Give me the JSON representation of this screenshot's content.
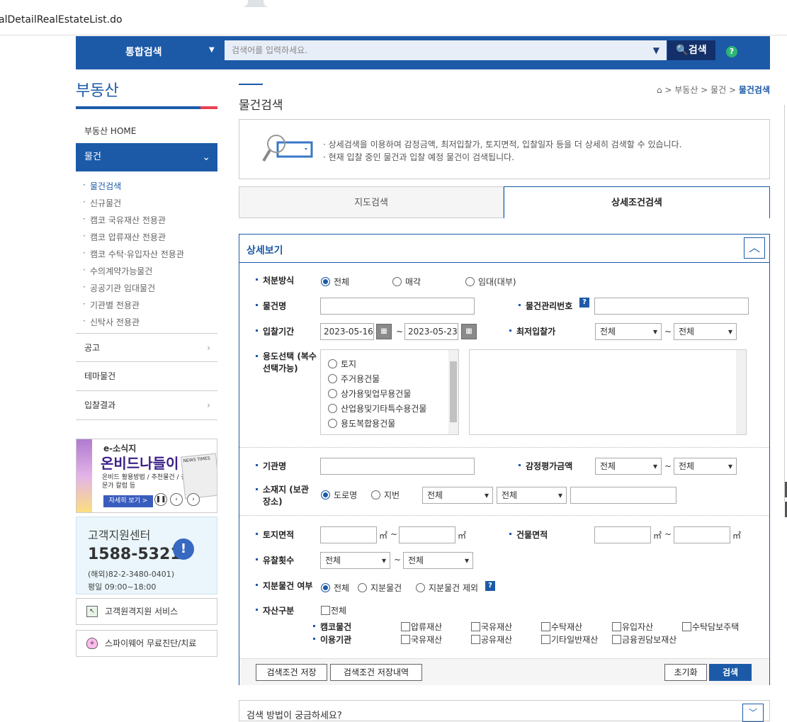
{
  "browser": {
    "url": "alDetailRealEstateList.do"
  },
  "top": {
    "scope": "통합검색",
    "placeholder": "검색어를 입력하세요.",
    "search_btn": "검색",
    "help": "?"
  },
  "lnb": {
    "title": "부동산",
    "home": "부동산 HOME",
    "current": "물건",
    "sub": [
      "물건검색",
      "신규물건",
      "캠코 국유재산 전용관",
      "캠코 압류재산 전용관",
      "캠코 수탁·유입자산 전용관",
      "수의계약가능물건",
      "공공기관 임대물건",
      "기관별 전용관",
      "신탁사 전용관"
    ],
    "menus": [
      "공고",
      "테마물건",
      "입찰결과"
    ]
  },
  "banner": {
    "t1": "e-소식지",
    "t2": "온비드나들이",
    "t3": "온비드 활용방법 / 추천물건 / 전문가 칼럼 등",
    "more": "자세히 보기 >",
    "paper": "NEWS TIMES"
  },
  "support": {
    "title": "고객지원센터",
    "phone": "1588-5321",
    "overseas": "(해외)82-2-3480-0401)",
    "hours": "평일 09:00~18:00"
  },
  "remote": "고객원격지원 서비스",
  "spyware": "스파이웨어 무료진단/치료",
  "page": {
    "title": "물건검색",
    "crumb": [
      "부동산",
      "물건",
      "물건검색"
    ],
    "info": [
      "· 상세검색을 이용하여 감정금액, 최저입찰가, 토지면적, 입찰일자 등을 더 상세히 검색할 수 있습니다.",
      "· 현재 입찰 중인 물건과 입찰 예정 물건이 검색됩니다."
    ],
    "tabs": [
      "지도검색",
      "상세조건검색"
    ]
  },
  "form": {
    "header": "상세보기",
    "disposal": {
      "label": "처분방식",
      "opts": [
        "전체",
        "매각",
        "임대(대부)"
      ]
    },
    "name_label": "물건명",
    "mgmt_label": "물건관리번호",
    "period": {
      "label": "입찰기간",
      "from": "2023-05-16",
      "to": "2023-05-23"
    },
    "minbid": {
      "label": "최저입찰가",
      "a": "전체",
      "b": "전체"
    },
    "usage": {
      "label": "용도선택 (복수선택가능)",
      "items": [
        "토지",
        "주거용건물",
        "상가용및업무용건물",
        "산업용및기타특수용건물",
        "용도복합용건물"
      ]
    },
    "org_label": "기관명",
    "appraisal": {
      "label": "감정평가금액",
      "a": "전체",
      "b": "전체"
    },
    "location": {
      "label": "소재지 (보관장소)",
      "opts": [
        "도로명",
        "지번"
      ],
      "s1": "전체",
      "s2": "전체"
    },
    "land": {
      "label": "토지면적",
      "unit": "㎡"
    },
    "bldg": {
      "label": "건물면적",
      "unit": "㎡"
    },
    "fail": {
      "label": "유찰횟수",
      "a": "전체",
      "b": "전체"
    },
    "share": {
      "label": "지분물건 여부",
      "opts": [
        "전체",
        "지분물건",
        "지분물건 제외"
      ]
    },
    "asset": {
      "label": "자산구분",
      "all": "전체",
      "row1_label": "캠코물건",
      "row2_label": "이용기관",
      "row1": [
        "압류재산",
        "국유재산",
        "수탁재산",
        "유입자산",
        "수탁담보주택"
      ],
      "row2": [
        "국유재산",
        "공유재산",
        "기타일반재산",
        "금융권담보재산"
      ]
    },
    "buttons": {
      "save": "검색조건 저장",
      "history": "검색조건 저장내역",
      "reset": "초기화",
      "search": "검색"
    }
  },
  "helpbox": "검색 방법이 궁금하세요?"
}
